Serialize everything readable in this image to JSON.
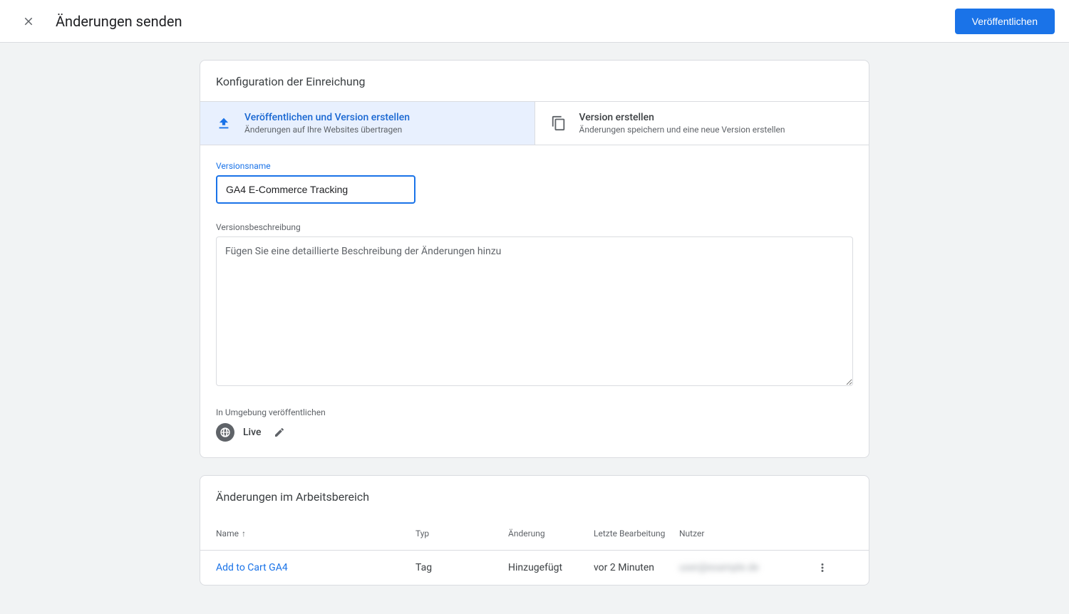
{
  "header": {
    "title": "Änderungen senden",
    "publishButton": "Veröffentlichen"
  },
  "config": {
    "cardTitle": "Konfiguration der Einreichung",
    "tabs": [
      {
        "title": "Veröffentlichen und Version erstellen",
        "sub": "Änderungen auf Ihre Websites übertragen"
      },
      {
        "title": "Version erstellen",
        "sub": "Änderungen speichern und eine neue Version erstellen"
      }
    ],
    "versionNameLabel": "Versionsname",
    "versionNameValue": "GA4 E-Commerce Tracking",
    "versionDescLabel": "Versionsbeschreibung",
    "versionDescPlaceholder": "Fügen Sie eine detaillierte Beschreibung der Änderungen hinzu",
    "envLabel": "In Umgebung veröffentlichen",
    "envValue": "Live"
  },
  "changes": {
    "cardTitle": "Änderungen im Arbeitsbereich",
    "columns": {
      "name": "Name",
      "type": "Typ",
      "change": "Änderung",
      "lastEdit": "Letzte Bearbeitung",
      "user": "Nutzer"
    },
    "rows": [
      {
        "name": "Add to Cart GA4",
        "type": "Tag",
        "change": "Hinzugefügt",
        "lastEdit": "vor 2 Minuten",
        "user": "user@example.de"
      }
    ]
  }
}
